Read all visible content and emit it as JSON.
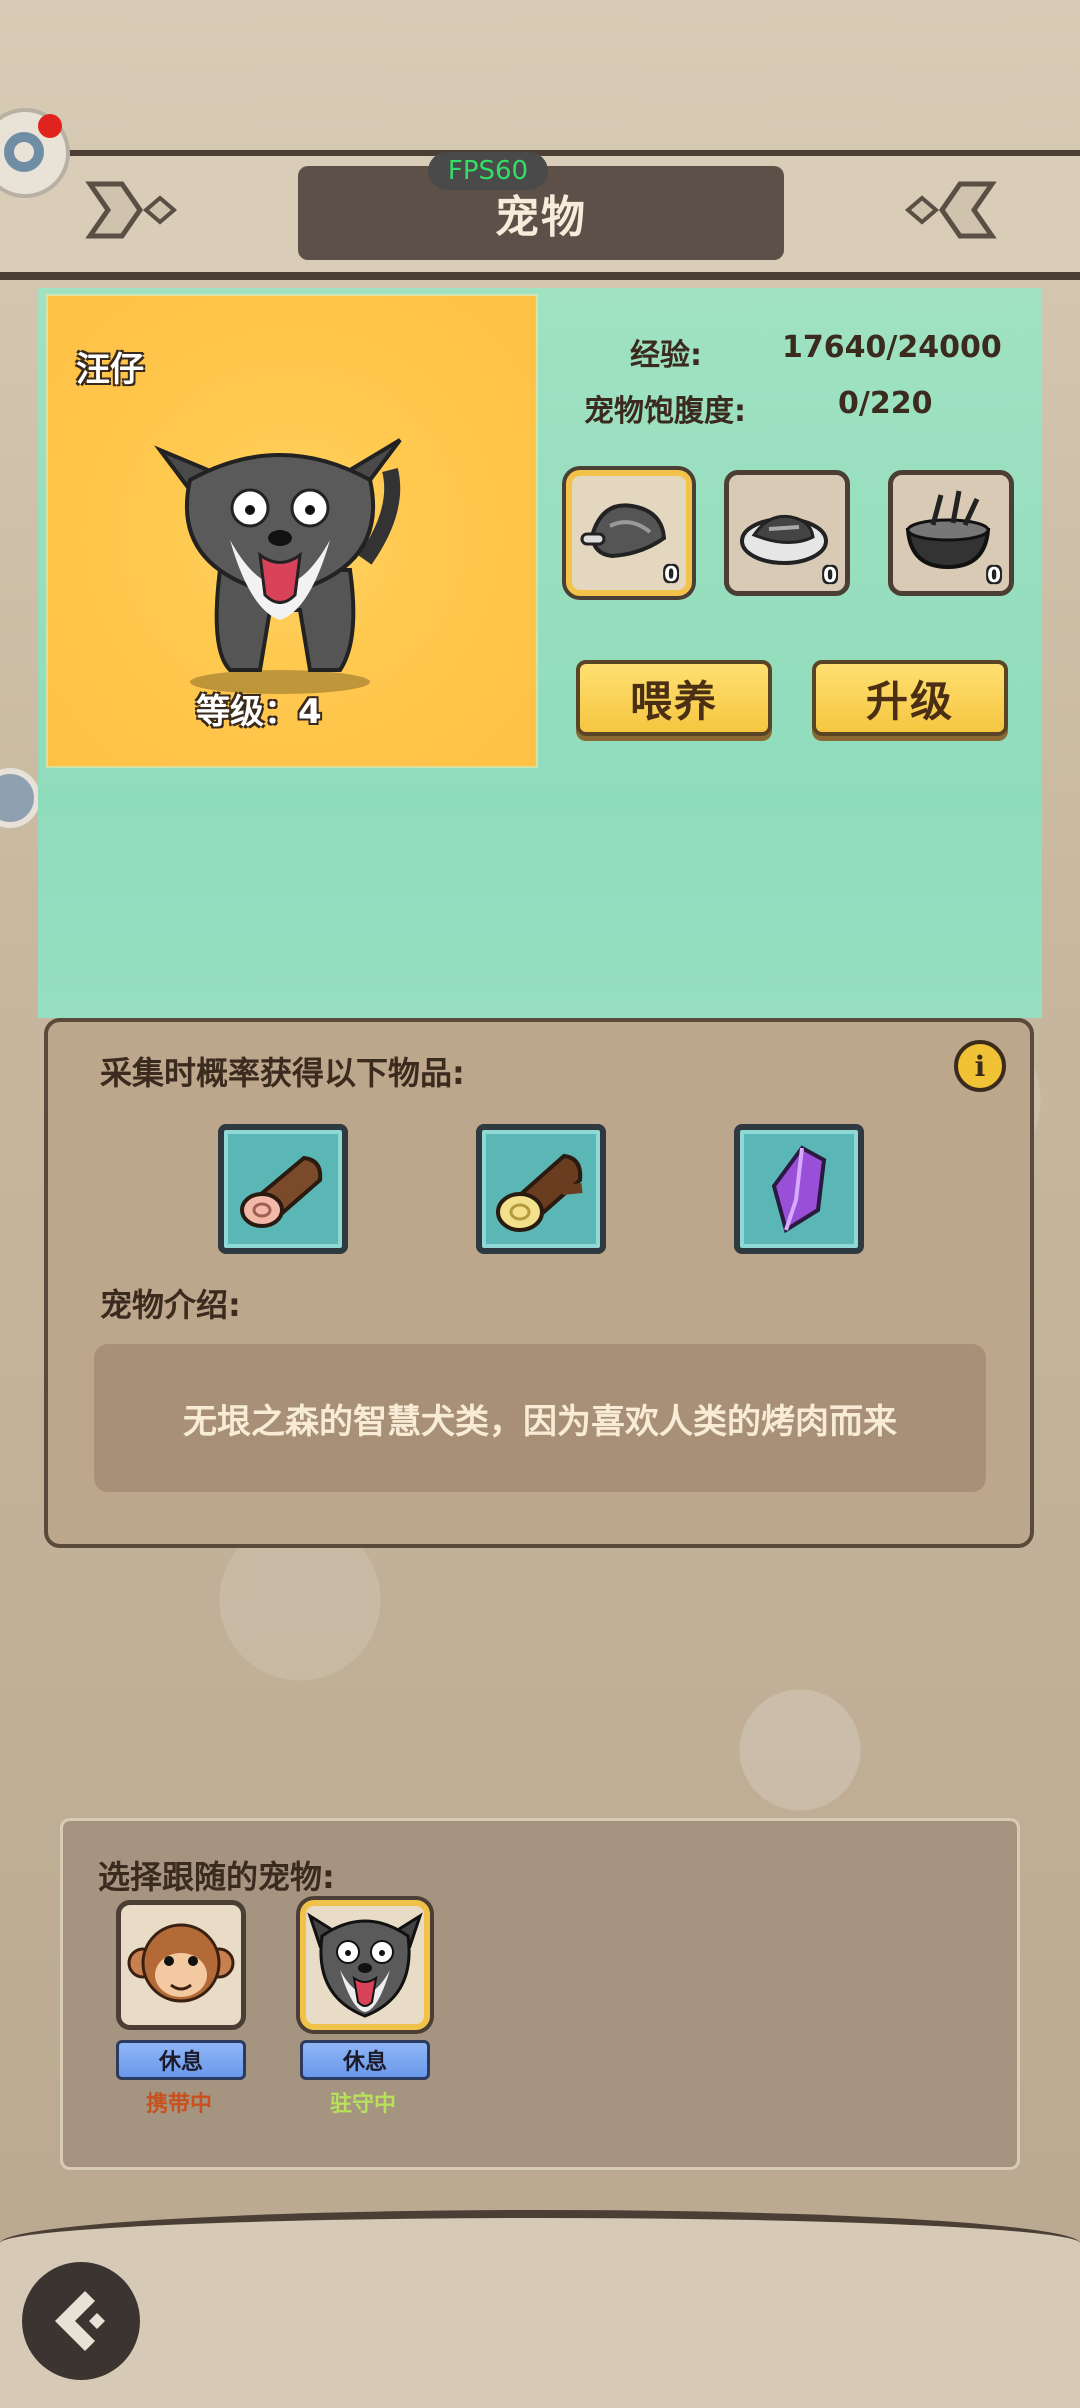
{
  "system": {
    "fps": "FPS60"
  },
  "header": {
    "title": "宠物"
  },
  "pet": {
    "name": "汪仔",
    "level_text": "等级：4",
    "exp_label": "经验:",
    "exp_value": "17640/24000",
    "satiety_label": "宠物饱腹度:",
    "satiety_value": "0/220"
  },
  "food_items": [
    {
      "name": "raw-meat-icon",
      "count": "0"
    },
    {
      "name": "grilled-meat-plate-icon",
      "count": "0"
    },
    {
      "name": "stew-bowl-icon",
      "count": "0"
    }
  ],
  "actions": {
    "feed": "喂养",
    "upgrade": "升级"
  },
  "drops": {
    "heading": "采集时概率获得以下物品:",
    "items": [
      "wood-log-icon",
      "thick-log-icon",
      "purple-crystal-icon"
    ]
  },
  "intro": {
    "heading": "宠物介绍:",
    "text": "无垠之森的智慧犬类，因为喜欢人类的烤肉而来"
  },
  "follow": {
    "heading": "选择跟随的宠物:",
    "pets": [
      {
        "avatar": "monkey-avatar-icon",
        "button": "休息",
        "status": "携带中",
        "status_color": "#c8511e"
      },
      {
        "avatar": "dog-avatar-icon",
        "button": "休息",
        "status": "驻守中",
        "status_color": "#b8e05a"
      }
    ]
  },
  "colors": {
    "accent_yellow": "#f5c640",
    "teal": "#8fdcbc",
    "panel": "#bca68c"
  }
}
